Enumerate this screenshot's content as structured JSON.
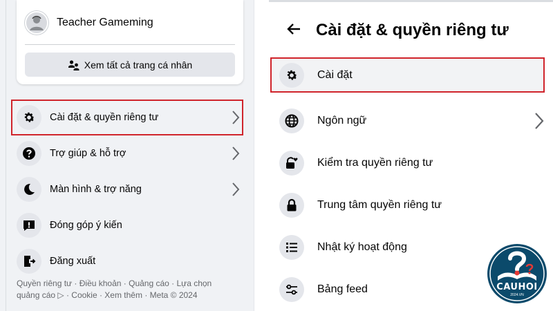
{
  "left_panel": {
    "profile": {
      "name": "Teacher Gameming",
      "see_all_label": "Xem tất cả trang cá nhân"
    },
    "menu": [
      {
        "label": "Cài đặt & quyền riêng tư",
        "icon": "gear-icon",
        "chevron": true,
        "selected": true
      },
      {
        "label": "Trợ giúp & hỗ trợ",
        "icon": "question-icon",
        "chevron": true,
        "selected": false
      },
      {
        "label": "Màn hình & trợ năng",
        "icon": "moon-icon",
        "chevron": true,
        "selected": false
      },
      {
        "label": "Đóng góp ý kiến",
        "icon": "feedback-icon",
        "chevron": false,
        "selected": false
      },
      {
        "label": "Đăng xuất",
        "icon": "logout-icon",
        "chevron": false,
        "selected": false
      }
    ],
    "footer": {
      "line1": "Quyền riêng tư · Điều khoản · Quảng cáo · Lựa chọn",
      "line2": "quảng cáo ▷ · Cookie · Xem thêm · Meta © 2024"
    }
  },
  "right_panel": {
    "title": "Cài đặt & quyền riêng tư",
    "back_icon": "back-arrow-icon",
    "menu": [
      {
        "label": "Cài đặt",
        "icon": "gear-icon",
        "chevron": false,
        "selected": true
      },
      {
        "label": "Ngôn ngữ",
        "icon": "globe-icon",
        "chevron": true,
        "selected": false
      },
      {
        "label": "Kiểm tra quyền riêng tư",
        "icon": "lock-heart-icon",
        "chevron": false,
        "selected": false
      },
      {
        "label": "Trung tâm quyền riêng tư",
        "icon": "lock-icon",
        "chevron": false,
        "selected": false
      },
      {
        "label": "Nhật ký hoạt động",
        "icon": "list-icon",
        "chevron": false,
        "selected": false
      },
      {
        "label": "Bảng feed",
        "icon": "sliders-icon",
        "chevron": false,
        "selected": false
      }
    ]
  },
  "watermark": {
    "text": "CAUHOI",
    "sub": "2024.VN",
    "colors": {
      "primary": "#0b4a6b",
      "accent": "#e53935"
    }
  },
  "colors": {
    "highlight_border": "#d0242b",
    "icon_circle": "#e4e6eb",
    "panel_bg": "#f0f2f5",
    "secondary_text": "#65676b"
  }
}
